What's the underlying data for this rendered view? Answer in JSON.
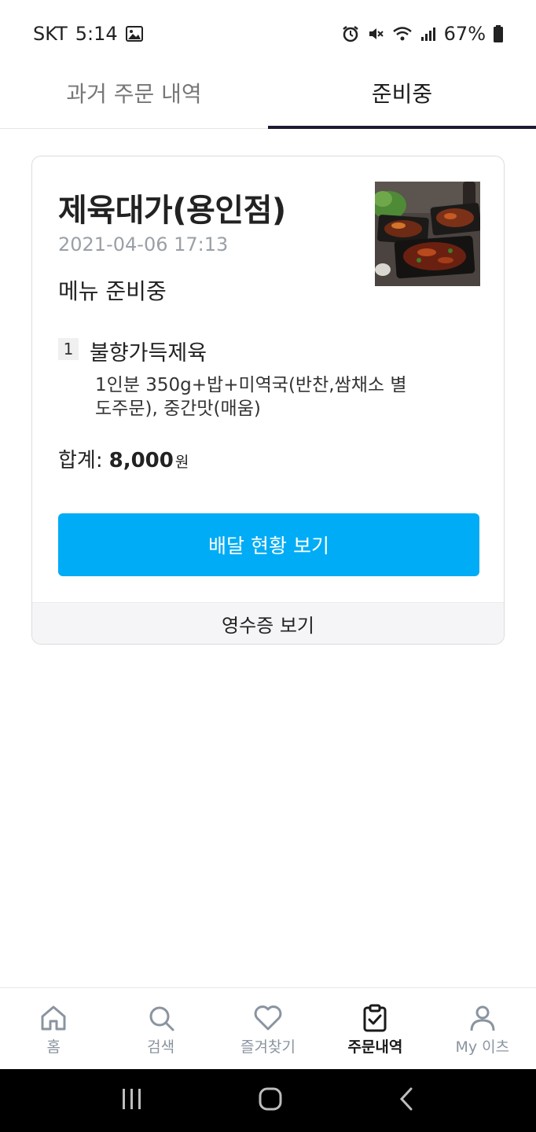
{
  "status_bar": {
    "carrier": "SKT",
    "time": "5:14",
    "battery": "67%"
  },
  "tabs": [
    {
      "label": "과거 주문 내역",
      "active": false
    },
    {
      "label": "준비중",
      "active": true
    }
  ],
  "order": {
    "store_name": "제육대가(용인점)",
    "datetime": "2021-04-06 17:13",
    "status": "메뉴 준비중",
    "items": [
      {
        "qty": "1",
        "name": "불향가득제육",
        "options": "1인분 350g+밥+미역국(반찬,쌈채소 별도주문), 중간맛(매움)"
      }
    ],
    "total_label": "합계:",
    "total_amount": "8,000",
    "currency": "원",
    "track_button": "배달 현황 보기",
    "receipt_button": "영수증 보기"
  },
  "bottom_nav": [
    {
      "label": "홈",
      "icon": "home-icon",
      "active": false
    },
    {
      "label": "검색",
      "icon": "search-icon",
      "active": false
    },
    {
      "label": "즐겨찾기",
      "icon": "heart-icon",
      "active": false
    },
    {
      "label": "주문내역",
      "icon": "clipboard-check-icon",
      "active": true
    },
    {
      "label": "My 이츠",
      "icon": "person-icon",
      "active": false
    }
  ],
  "colors": {
    "accent": "#00acf5",
    "tab_indicator": "#1d1a33",
    "muted": "#8a94a0"
  }
}
